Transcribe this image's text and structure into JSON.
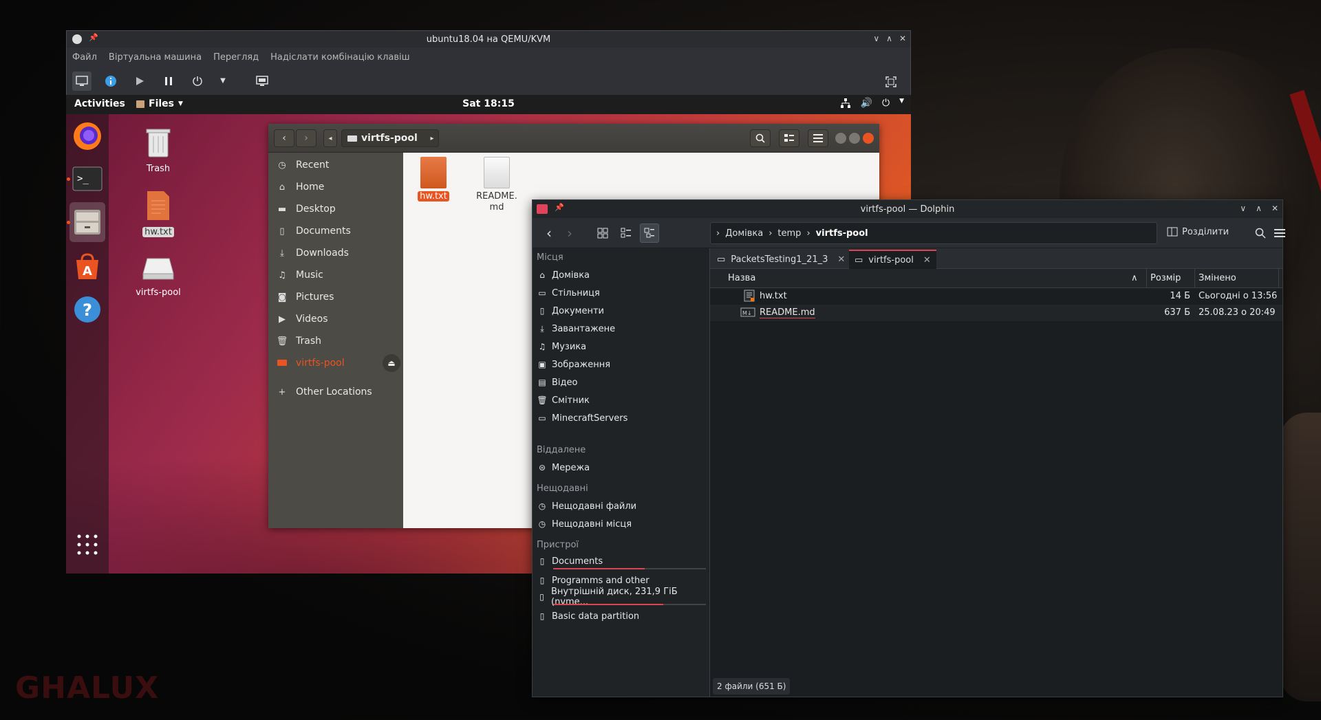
{
  "wallpaper": {
    "watermark": "GHALUX"
  },
  "qemu": {
    "title": "ubuntu18.04 на QEMU/KVM",
    "menu": [
      "Файл",
      "Віртуальна машина",
      "Перегляд",
      "Надіслати комбінацію клавіш"
    ]
  },
  "ubuntu": {
    "activities": "Activities",
    "app_menu": "Files",
    "clock": "Sat 18:15",
    "desktop_icons": {
      "trash": "Trash",
      "hwtxt": "hw.txt",
      "virtfs": "virtfs-pool"
    }
  },
  "nautilus": {
    "path": "virtfs-pool",
    "sidebar": {
      "recent": "Recent",
      "home": "Home",
      "desktop": "Desktop",
      "documents": "Documents",
      "downloads": "Downloads",
      "music": "Music",
      "pictures": "Pictures",
      "videos": "Videos",
      "trash": "Trash",
      "virtfs": "virtfs-pool",
      "other": "Other Locations"
    },
    "files": {
      "hw": "hw.txt",
      "readme_1": "README.",
      "readme_2": "md"
    }
  },
  "dolphin": {
    "title": "virtfs-pool — Dolphin",
    "breadcrumb": {
      "home": "Домівка",
      "temp": "temp",
      "current": "virtfs-pool"
    },
    "split_label": "Розділити",
    "places": {
      "head_places": "Місця",
      "home": "Домівка",
      "desktop": "Стільниця",
      "documents": "Документи",
      "downloads": "Завантажене",
      "music": "Музика",
      "images": "Зображення",
      "video": "Відео",
      "trash": "Смітник",
      "minecraft": "MinecraftServers",
      "head_remote": "Віддалене",
      "network": "Мережа",
      "head_recent": "Нещодавні",
      "recent_files": "Нещодавні файли",
      "recent_places": "Нещодавні місця",
      "head_devices": "Пристрої",
      "dev_documents": "Documents",
      "dev_programms": "Programms and other",
      "dev_internal": "Внутрішній диск, 231,9 ГіБ (nvme...",
      "dev_basic": "Basic data partition"
    },
    "device_usage": {
      "documents": 0.6,
      "internal": 0.72
    },
    "tabs": [
      "PacketsTesting1_21_3",
      "virtfs-pool"
    ],
    "columns": {
      "name": "Назва",
      "size": "Розмір",
      "modified": "Змінено"
    },
    "rows": [
      {
        "name": "hw.txt",
        "size": "14 Б",
        "modified": "Сьогодні о 13:56"
      },
      {
        "name": "README.md",
        "size": "637 Б",
        "modified": "25.08.23 о 20:49"
      }
    ],
    "status": "2 файли (651 Б)"
  },
  "colors": {
    "accent_ubuntu": "#e95420",
    "accent_kde": "#da4453"
  }
}
